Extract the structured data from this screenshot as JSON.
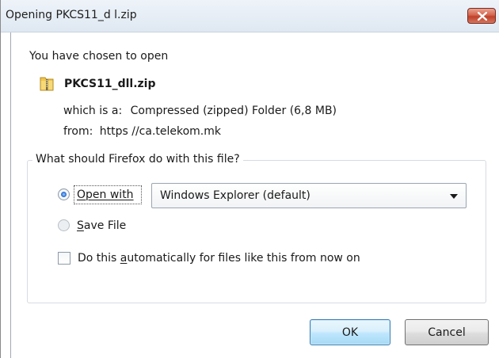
{
  "window": {
    "title": "Opening PKCS11_d l.zip"
  },
  "dialog": {
    "intro": "You have chosen to open",
    "file_name": "PKCS11_dll.zip",
    "which_is_label": "which is a:",
    "which_is_value": "Compressed (zipped) Folder (6,8 MB)",
    "from_label": "from:",
    "from_value": "https //ca.telekom.mk"
  },
  "action_group": {
    "legend": "What should Firefox do with this file?",
    "open_with": {
      "label_first": "O",
      "label_rest": "pen with",
      "selected": true
    },
    "application_select": {
      "value": "Windows Explorer (default)"
    },
    "save_file": {
      "label_first": "S",
      "label_rest": "ave File",
      "selected": false
    },
    "auto_checkbox": {
      "label_before": "Do this ",
      "label_underlined": "a",
      "label_after": "utomatically for files like this from now on",
      "checked": false
    }
  },
  "buttons": {
    "ok": "OK",
    "cancel": "Cancel"
  },
  "icons": {
    "close": "close-icon",
    "file": "zip-folder-icon",
    "dropdown": "chevron-down-icon"
  },
  "colors": {
    "close_button": "#c0402a",
    "ok_border": "#3c7fb1",
    "radio_selected": "#2c6ed5"
  }
}
